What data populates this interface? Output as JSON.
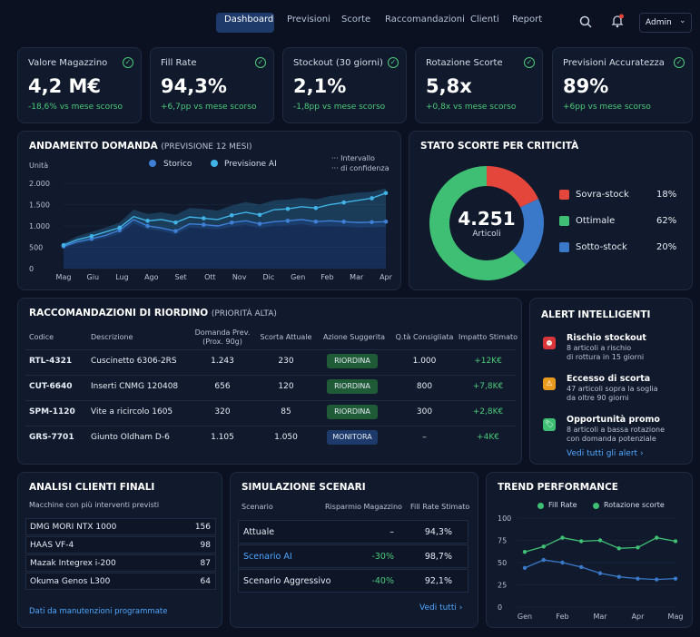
{
  "nav": {
    "items": [
      "Dashboard",
      "Previsioni",
      "Scorte",
      "Raccomandazioni",
      "Clienti",
      "Report"
    ],
    "user": "Admin"
  },
  "kpis": [
    {
      "title": "Valore Magazzino",
      "value": "4,2 M€",
      "delta": "-18,6% vs mese scorso"
    },
    {
      "title": "Fill Rate",
      "value": "94,3%",
      "delta": "+6,7pp vs mese scorso"
    },
    {
      "title": "Stockout (30 giorni)",
      "value": "2,1%",
      "delta": "-1,8pp vs mese scorso"
    },
    {
      "title": "Rotazione Scorte",
      "value": "5,8x",
      "delta": "+0,8x vs mese scorso"
    },
    {
      "title": "Previsioni Accuratezza",
      "value": "89%",
      "delta": "+6pp vs mese scorso"
    }
  ],
  "demand": {
    "title": "ANDAMENTO DOMANDA",
    "subtitle": "(PREVISIONE 12 MESI)",
    "unit": "Unità",
    "legend": [
      "Storico",
      "Previsione AI"
    ],
    "ci_legend": [
      "Intervallo",
      "di confidenza"
    ]
  },
  "stock": {
    "title": "STATO SCORTE PER CRITICITÀ",
    "total": "4.251",
    "total_label": "Articoli",
    "items": [
      {
        "label": "Sovra-stock",
        "pct": "18%",
        "color": "#e5463c",
        "value": 18
      },
      {
        "label": "Ottimale",
        "pct": "62%",
        "color": "#3fbf74",
        "value": 62
      },
      {
        "label": "Sotto-stock",
        "pct": "20%",
        "color": "#3a78c9",
        "value": 20
      }
    ]
  },
  "reorder": {
    "title": "RACCOMANDAZIONI DI RIORDINO",
    "subtitle": "(PRIORITÀ ALTA)",
    "headers": [
      "Codice",
      "Descrizione",
      "Domanda Prev.",
      "(Prox. 90g)",
      "Scorta Attuale",
      "Azione Suggerita",
      "Q.tà Consigliata",
      "Impatto Stimato"
    ],
    "rows": [
      {
        "code": "RTL-4321",
        "desc": "Cuscinetto 6306-2RS",
        "demand": "1.243",
        "stock": "230",
        "action": "RIORDINA",
        "qty": "1.000",
        "impact": "+12K€"
      },
      {
        "code": "CUT-6640",
        "desc": "Inserti CNMG 120408",
        "demand": "656",
        "stock": "120",
        "action": "RIORDINA",
        "qty": "800",
        "impact": "+7,8K€"
      },
      {
        "code": "SPM-1120",
        "desc": "Vite a ricircolo 1605",
        "demand": "320",
        "stock": "85",
        "action": "RIORDINA",
        "qty": "300",
        "impact": "+2,8K€"
      },
      {
        "code": "GRS-7701",
        "desc": "Giunto Oldham D-6",
        "demand": "1.105",
        "stock": "1.050",
        "action": "MONITORA",
        "qty": "–",
        "impact": "+4K€"
      }
    ]
  },
  "alerts": {
    "title": "ALERT INTELLIGENTI",
    "items": [
      {
        "title": "Rischio stockout",
        "l1": "8 articoli a rischio",
        "l2": "di rottura in 15 giorni",
        "color": "#d9343a"
      },
      {
        "title": "Eccesso di scorta",
        "l1": "47 articoli sopra la soglia",
        "l2": "da oltre 90 giorni",
        "color": "#e89a1e"
      },
      {
        "title": "Opportunità promo",
        "l1": "8 articoli a bassa rotazione",
        "l2": "con domanda potenziale",
        "color": "#3fbf74"
      }
    ],
    "link": "Vedi tutti gli alert ›"
  },
  "clients": {
    "title": "ANALISI CLIENTI FINALI",
    "subtitle": "Macchine con più interventi previsti",
    "rows": [
      {
        "name": "DMG MORI NTX 1000",
        "n": "156"
      },
      {
        "name": "HAAS VF-4",
        "n": "98"
      },
      {
        "name": "Mazak Integrex i-200",
        "n": "87"
      },
      {
        "name": "Okuma Genos L300",
        "n": "64"
      }
    ],
    "footer": "Dati da manutenzioni programmate"
  },
  "scenarios": {
    "title": "SIMULAZIONE SCENARI",
    "headers": [
      "Scenario",
      "Risparmio Magazzino",
      "Fill Rate Stimato"
    ],
    "rows": [
      {
        "name": "Attuale",
        "saving": "–",
        "fill": "94,3%"
      },
      {
        "name": "Scenario AI",
        "saving": "-30%",
        "fill": "98,7%"
      },
      {
        "name": "Scenario Aggressivo",
        "saving": "-40%",
        "fill": "92,1%"
      }
    ],
    "link": "Vedi tutti ›"
  },
  "chart_data": [
    {
      "type": "line",
      "title": "ANDAMENTO DOMANDA",
      "ylabel": "Unità",
      "categories": [
        "Mag",
        "Giu",
        "Lug",
        "Ago",
        "Set",
        "Ott",
        "Nov",
        "Dic",
        "Gen",
        "Feb",
        "Mar",
        "Apr"
      ],
      "ylim": [
        0,
        2000
      ],
      "yticks": [
        "0",
        "500",
        "1.000",
        "1.500",
        "2.000"
      ],
      "series": [
        {
          "name": "Storico",
          "values": [
            520,
            630,
            700,
            780,
            900,
            1150,
            1000,
            950,
            880,
            1050,
            1030,
            1000,
            1080,
            1120,
            1050,
            1100,
            1120,
            1150,
            1100,
            1120,
            1100,
            1080,
            1090,
            1100
          ]
        },
        {
          "name": "Previsione AI",
          "values": [
            550,
            680,
            760,
            860,
            960,
            1220,
            1120,
            1150,
            1080,
            1210,
            1180,
            1150,
            1250,
            1320,
            1260,
            1380,
            1400,
            1450,
            1420,
            1500,
            1550,
            1600,
            1650,
            1770
          ]
        }
      ],
      "ci_lower": [
        480,
        580,
        640,
        720,
        820,
        1050,
        920,
        880,
        800,
        960,
        940,
        920,
        980,
        1020,
        950,
        1000,
        1010,
        1040,
        990,
        1000,
        990,
        960,
        970,
        980
      ],
      "ci_upper": [
        600,
        760,
        860,
        960,
        1080,
        1380,
        1280,
        1320,
        1260,
        1420,
        1400,
        1360,
        1480,
        1560,
        1500,
        1600,
        1620,
        1660,
        1620,
        1700,
        1740,
        1780,
        1800,
        1880
      ]
    },
    {
      "type": "line",
      "title": "TREND PERFORMANCE",
      "categories": [
        "Gen",
        "Feb",
        "Mar",
        "Apr",
        "Mag"
      ],
      "ylim": [
        0,
        100
      ],
      "yticks": [
        "0",
        "25",
        "50",
        "75",
        "100"
      ],
      "series": [
        {
          "name": "Fill Rate",
          "values": [
            62,
            68,
            78,
            74,
            75,
            66,
            67,
            78,
            74
          ]
        },
        {
          "name": "Rotazione scorte",
          "values": [
            44,
            53,
            50,
            45,
            38,
            34,
            32,
            31,
            32
          ]
        }
      ]
    }
  ],
  "perf": {
    "title": "TREND PERFORMANCE",
    "legend": [
      "Fill Rate",
      "Rotazione scorte"
    ]
  }
}
